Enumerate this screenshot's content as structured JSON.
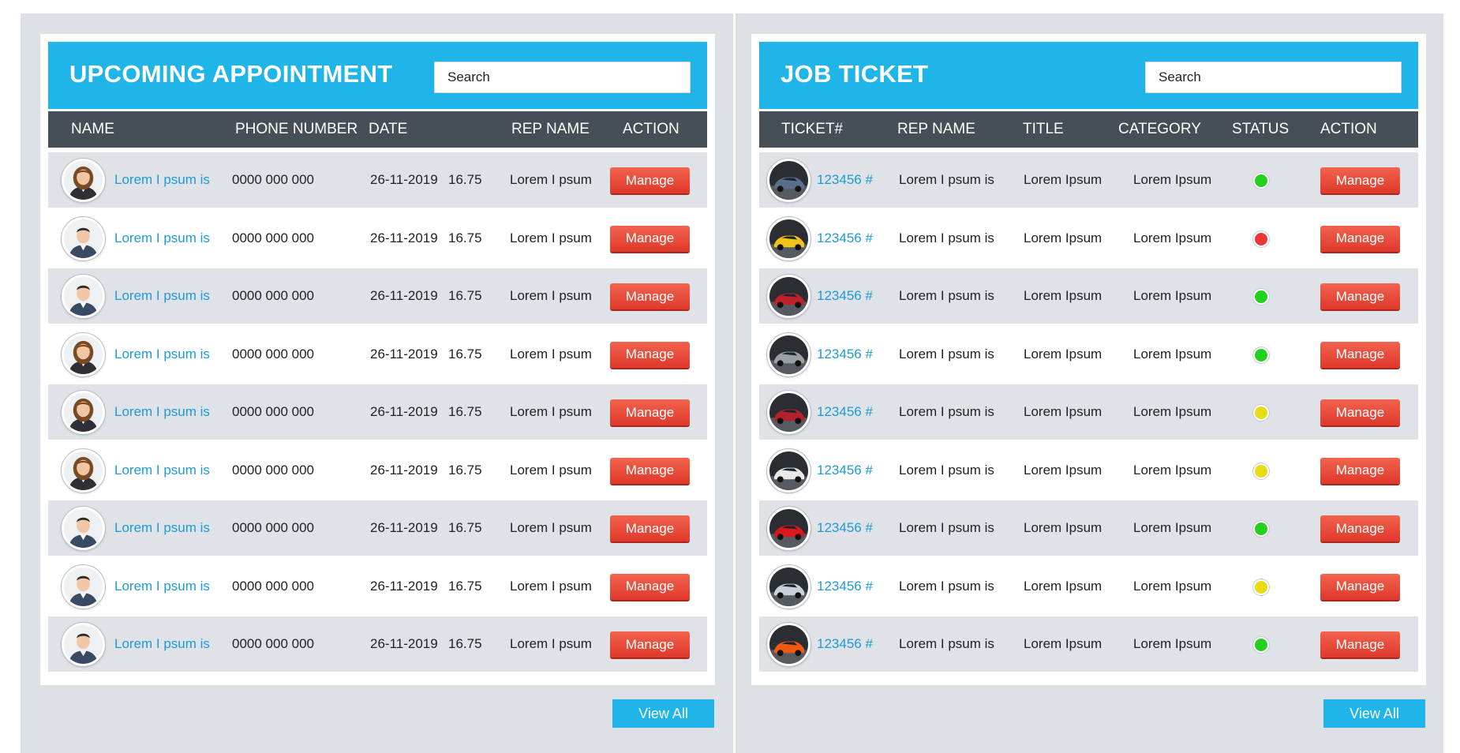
{
  "appointment": {
    "title": "UPCOMING APPOINTMENT",
    "search_placeholder": "Search",
    "headers": [
      "NAME",
      "PHONE NUMBER",
      "DATE",
      "REP NAME",
      "ACTION"
    ],
    "rows": [
      {
        "name": "Lorem I psum is",
        "phone": "0000 000 000",
        "date": "26-11-2019",
        "time": "16.75",
        "rep": "Lorem I psum",
        "action": "Manage",
        "avatar": "avatar-woman"
      },
      {
        "name": "Lorem I psum is",
        "phone": "0000 000 000",
        "date": "26-11-2019",
        "time": "16.75",
        "rep": "Lorem I psum",
        "action": "Manage",
        "avatar": "avatar-man"
      },
      {
        "name": "Lorem I psum is",
        "phone": "0000 000 000",
        "date": "26-11-2019",
        "time": "16.75",
        "rep": "Lorem I psum",
        "action": "Manage",
        "avatar": "avatar-man"
      },
      {
        "name": "Lorem I psum is",
        "phone": "0000 000 000",
        "date": "26-11-2019",
        "time": "16.75",
        "rep": "Lorem I psum",
        "action": "Manage",
        "avatar": "avatar-woman"
      },
      {
        "name": "Lorem I psum is",
        "phone": "0000 000 000",
        "date": "26-11-2019",
        "time": "16.75",
        "rep": "Lorem I psum",
        "action": "Manage",
        "avatar": "avatar-woman"
      },
      {
        "name": "Lorem I psum is",
        "phone": "0000 000 000",
        "date": "26-11-2019",
        "time": "16.75",
        "rep": "Lorem I psum",
        "action": "Manage",
        "avatar": "avatar-woman"
      },
      {
        "name": "Lorem I psum is",
        "phone": "0000 000 000",
        "date": "26-11-2019",
        "time": "16.75",
        "rep": "Lorem I psum",
        "action": "Manage",
        "avatar": "avatar-man"
      },
      {
        "name": "Lorem I psum is",
        "phone": "0000 000 000",
        "date": "26-11-2019",
        "time": "16.75",
        "rep": "Lorem I psum",
        "action": "Manage",
        "avatar": "avatar-man"
      },
      {
        "name": "Lorem I psum is",
        "phone": "0000 000 000",
        "date": "26-11-2019",
        "time": "16.75",
        "rep": "Lorem I psum",
        "action": "Manage",
        "avatar": "avatar-man"
      }
    ],
    "view_all": "View All"
  },
  "job_ticket": {
    "title": "JOB TICKET",
    "search_placeholder": "Search",
    "headers": [
      "TICKET#",
      "REP NAME",
      "TITLE",
      "CATEGORY",
      "STATUS",
      "ACTION"
    ],
    "rows": [
      {
        "ticket": "123456 #",
        "rep": "Lorem I psum is",
        "title": "Lorem Ipsum",
        "category": "Lorem Ipsum",
        "status": "green",
        "action": "Manage",
        "car_color": "#5b6f8c"
      },
      {
        "ticket": "123456 #",
        "rep": "Lorem I psum is",
        "title": "Lorem Ipsum",
        "category": "Lorem Ipsum",
        "status": "red",
        "action": "Manage",
        "car_color": "#f0c419"
      },
      {
        "ticket": "123456 #",
        "rep": "Lorem I psum is",
        "title": "Lorem Ipsum",
        "category": "Lorem Ipsum",
        "status": "green",
        "action": "Manage",
        "car_color": "#c0202a"
      },
      {
        "ticket": "123456 #",
        "rep": "Lorem I psum is",
        "title": "Lorem Ipsum",
        "category": "Lorem Ipsum",
        "status": "green",
        "action": "Manage",
        "car_color": "#9aa0a6"
      },
      {
        "ticket": "123456 #",
        "rep": "Lorem I psum is",
        "title": "Lorem Ipsum",
        "category": "Lorem Ipsum",
        "status": "yellow",
        "action": "Manage",
        "car_color": "#b3222b"
      },
      {
        "ticket": "123456 #",
        "rep": "Lorem I psum is",
        "title": "Lorem Ipsum",
        "category": "Lorem Ipsum",
        "status": "yellow",
        "action": "Manage",
        "car_color": "#e8e8e8"
      },
      {
        "ticket": "123456 #",
        "rep": "Lorem I psum is",
        "title": "Lorem Ipsum",
        "category": "Lorem Ipsum",
        "status": "green",
        "action": "Manage",
        "car_color": "#d9181e"
      },
      {
        "ticket": "123456 #",
        "rep": "Lorem I psum is",
        "title": "Lorem Ipsum",
        "category": "Lorem Ipsum",
        "status": "yellow",
        "action": "Manage",
        "car_color": "#c9d1d8"
      },
      {
        "ticket": "123456 #",
        "rep": "Lorem I psum is",
        "title": "Lorem Ipsum",
        "category": "Lorem Ipsum",
        "status": "green",
        "action": "Manage",
        "car_color": "#f05a12"
      }
    ],
    "view_all": "View All"
  },
  "colors": {
    "accent": "#20b5e8",
    "header_dark": "#474f56",
    "button_red": "#e0382b",
    "link_blue": "#1e9ad6",
    "status_green": "#22d01f",
    "status_red": "#e83838",
    "status_yellow": "#e7db13"
  }
}
